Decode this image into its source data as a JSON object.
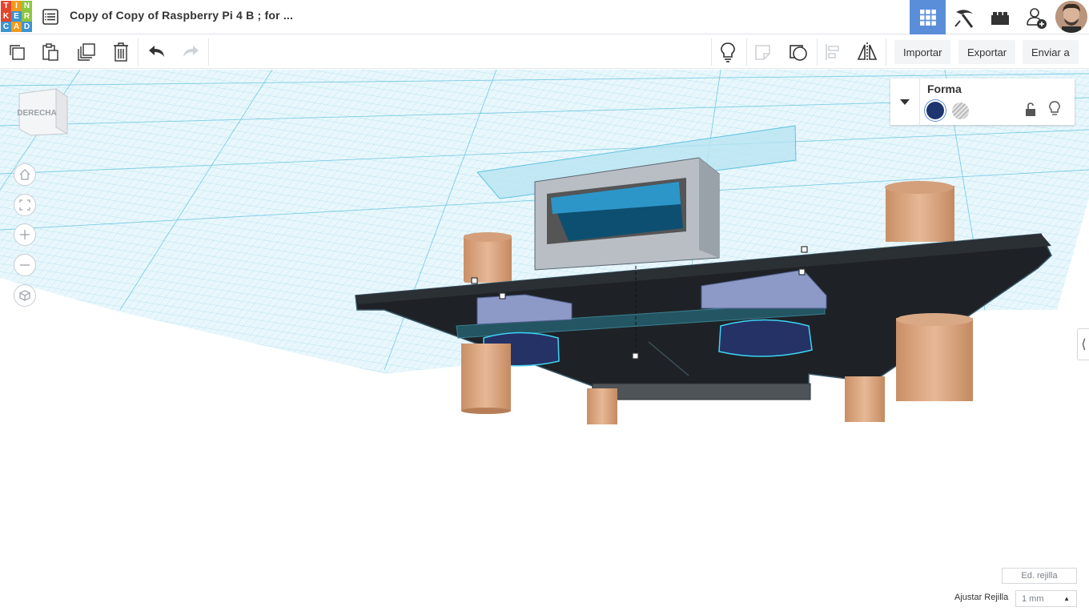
{
  "app": {
    "logo_letters": [
      "T",
      "I",
      "N",
      "K",
      "E",
      "R",
      "C",
      "A",
      "D"
    ],
    "logo_colors": [
      "#e2462c",
      "#f39a1c",
      "#8dc63f",
      "#e2462c",
      "#3c94cf",
      "#8dc63f",
      "#3c94cf",
      "#f39a1c",
      "#3c94cf"
    ],
    "design_title": "Copy of Copy of Raspberry Pi 4 B ; for ..."
  },
  "topnav": {
    "icons": [
      "grid-view-icon",
      "pickaxe-icon",
      "bricks-icon",
      "add-user-icon",
      "user-avatar"
    ],
    "active_color": "#5a8ed8"
  },
  "toolbar": {
    "tools": [
      "copy-icon",
      "paste-icon",
      "duplicate-icon",
      "delete-icon",
      "undo-icon",
      "redo-icon"
    ],
    "right_tools": [
      "light-bulb-icon",
      "note-icon",
      "shape-group-icon",
      "align-icon",
      "mirror-icon"
    ],
    "import_label": "Importar",
    "export_label": "Exportar",
    "send_label": "Enviar a"
  },
  "viewcube": {
    "label": "DERECHA"
  },
  "nav_controls": [
    "home-view-icon",
    "fit-view-icon",
    "zoom-in-icon",
    "zoom-out-icon",
    "perspective-icon"
  ],
  "inspector": {
    "title": "Forma",
    "solid_color": "#1e3570"
  },
  "grid_controls": {
    "edit_grid_label": "Ed. rejilla",
    "snap_label": "Ajustar Rejilla",
    "snap_value": "1 mm"
  }
}
